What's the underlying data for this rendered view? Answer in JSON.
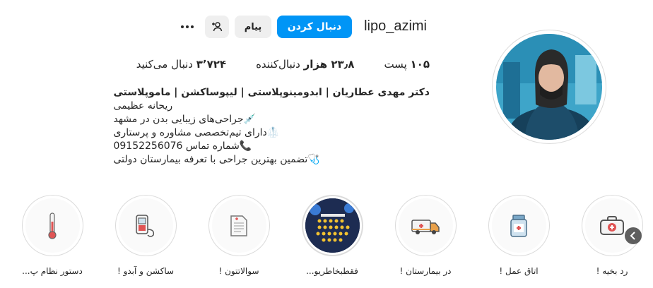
{
  "profile": {
    "username": "lipo_azimi",
    "follow_label": "دنبال کردن",
    "message_label": "پیام",
    "icons": {
      "suggest": "person-plus-icon",
      "more": "more-options-icon"
    }
  },
  "stats": {
    "posts": {
      "value": "۱۰۵",
      "label": "پست"
    },
    "followers": {
      "value": "۲۳٫۸ هزار",
      "label": "دنبال‌کننده"
    },
    "following": {
      "value": "۳٬۷۲۴",
      "label": "دنبال می‌کنید"
    }
  },
  "bio": {
    "full_name": "دکتر مهدی عطاریان | ابدومینوپلاستی | لیپوساکشن | ماموپلاستی",
    "lines": [
      "ریحانه عظیمی",
      "💉جراحی‌های زیبایی بدن در مشهد",
      "🥼دارای تیم‌تخصصی مشاوره و پرستاری",
      "📞شماره تماس 09152256076",
      "🩺تضمین بهترین جراحی با تعرفه بیمارستان دولتی"
    ]
  },
  "highlights": [
    {
      "label": "رد بخیه !",
      "icon": "first-aid-kit-icon"
    },
    {
      "label": "اتاق عمل !",
      "icon": "medicine-bottle-icon"
    },
    {
      "label": "در بیمارستان !",
      "icon": "ambulance-icon"
    },
    {
      "label": "فقطبخاطریو...",
      "icon": "faq-photo"
    },
    {
      "label": "سوالاتتون !",
      "icon": "document-icon"
    },
    {
      "label": "ساکشن و آبدو !",
      "icon": "suction-device-icon"
    },
    {
      "label": "دستور نظام پ...",
      "icon": "thermometer-icon"
    }
  ],
  "colors": {
    "primary": "#0095f6",
    "secondary_button": "#efefef",
    "text": "#262626",
    "border": "#dbdbdb"
  }
}
